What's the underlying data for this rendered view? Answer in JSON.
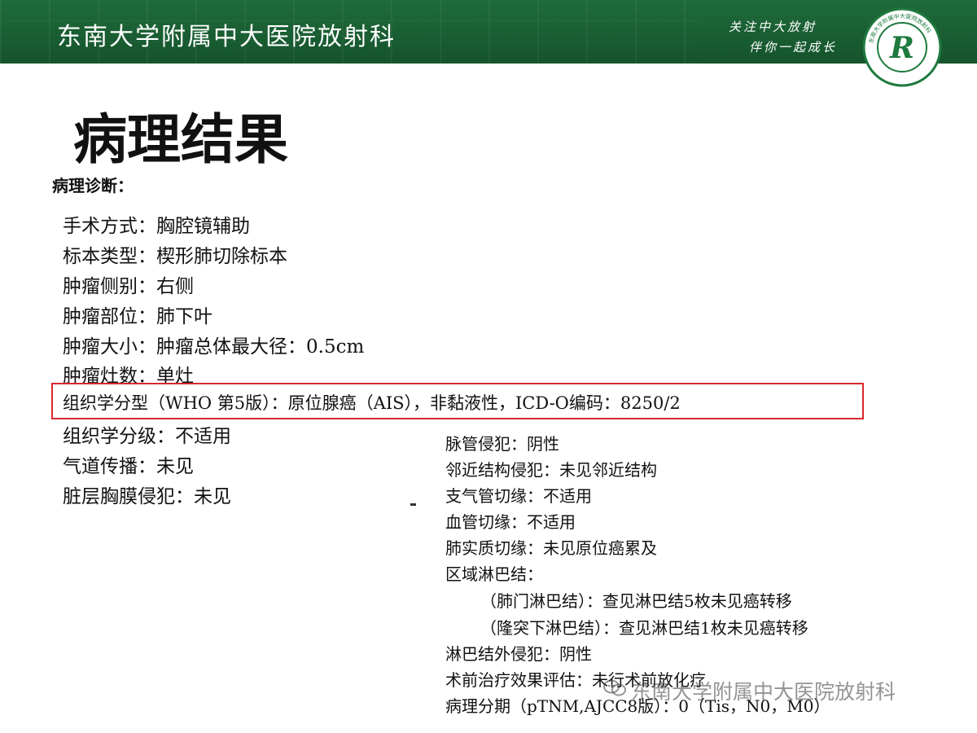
{
  "header": {
    "institution": "东南大学附属中大医院放射科",
    "slogan_line1": "关注中大放射",
    "slogan_line2": "伴你一起成长",
    "logo_letter": "R",
    "logo_ring_text": "东南大学附属中大医院放射科",
    "colors": {
      "banner": "#1f6b3a",
      "accent": "#d9272e",
      "logo_green": "#1e7a3e"
    }
  },
  "title": "病理结果",
  "diagnosis": {
    "label": "病理诊断：",
    "left_lines": [
      "手术方式：胸腔镜辅助",
      "标本类型：楔形肺切除标本",
      "肿瘤侧别：右侧",
      "肿瘤部位：肺下叶",
      "肿瘤大小：肿瘤总体最大径：0.5cm",
      "肿瘤灶数：单灶",
      "组织学分型（WHO 第5版）：原位腺癌（AIS），非黏液性，ICD-O编码：8250/2",
      "组织学分级：不适用",
      "气道传播：未见",
      "脏层胸膜侵犯：未见"
    ],
    "right_lines": [
      "脉管侵犯：阴性",
      "邻近结构侵犯：未见邻近结构",
      "支气管切缘：不适用",
      "血管切缘：不适用",
      "肺实质切缘：未见原位癌累及",
      "区域淋巴结：",
      "（肺门淋巴结）：查见淋巴结5枚未见癌转移",
      "（隆突下淋巴结）：查见淋巴结1枚未见癌转移",
      "淋巴结外侵犯：阴性",
      "术前治疗效果评估：未行术前放化疗",
      "病理分期（pTNM,AJCC8版）：0（Tis，N0，M0）"
    ]
  },
  "watermark": "东南大学附属中大医院放射科"
}
